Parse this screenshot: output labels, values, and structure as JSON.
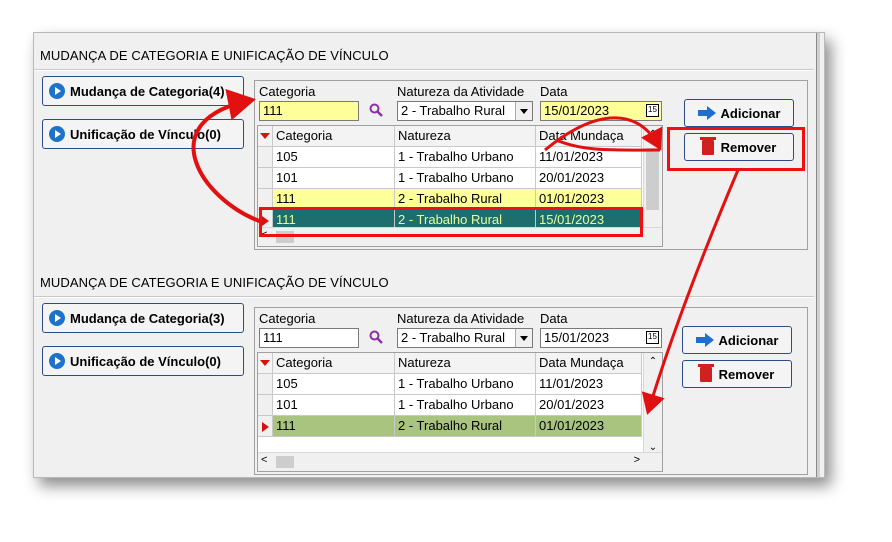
{
  "top": {
    "title": "MUDANÇA DE CATEGORIA E UNIFICAÇÃO DE VÍNCULO",
    "side_buttons": [
      {
        "label": "Mudança de Categoria(4)"
      },
      {
        "label": "Unificação de Vínculo(0)"
      }
    ],
    "labels": {
      "categoria": "Categoria",
      "natureza": "Natureza da Atividade",
      "data": "Data"
    },
    "inputs": {
      "categoria": "111",
      "natureza": "2 - Trabalho Rural",
      "data": "15/01/2023"
    },
    "grid_headers": [
      "Categoria",
      "Natureza",
      "Data Mundaça"
    ],
    "rows": [
      {
        "categoria": "105",
        "natureza": "1 - Trabalho Urbano",
        "data": "11/01/2023"
      },
      {
        "categoria": "101",
        "natureza": "1 - Trabalho Urbano",
        "data": "20/01/2023"
      },
      {
        "categoria": "111",
        "natureza": "2 - Trabalho Rural",
        "data": "01/01/2023"
      },
      {
        "categoria": "111",
        "natureza": "2 - Trabalho Rural",
        "data": "15/01/2023"
      }
    ],
    "add_label": "Adicionar",
    "remove_label": "Remover"
  },
  "bottom": {
    "title": "MUDANÇA DE CATEGORIA E UNIFICAÇÃO DE VÍNCULO",
    "side_buttons": [
      {
        "label": "Mudança de Categoria(3)"
      },
      {
        "label": "Unificação de Vínculo(0)"
      }
    ],
    "labels": {
      "categoria": "Categoria",
      "natureza": "Natureza da Atividade",
      "data": "Data"
    },
    "inputs": {
      "categoria": "111",
      "natureza": "2 - Trabalho Rural",
      "data": "15/01/2023"
    },
    "grid_headers": [
      "Categoria",
      "Natureza",
      "Data Mundaça"
    ],
    "rows": [
      {
        "categoria": "105",
        "natureza": "1 - Trabalho Urbano",
        "data": "11/01/2023"
      },
      {
        "categoria": "101",
        "natureza": "1 - Trabalho Urbano",
        "data": "20/01/2023"
      },
      {
        "categoria": "111",
        "natureza": "2 - Trabalho Rural",
        "data": "01/01/2023"
      }
    ],
    "add_label": "Adicionar",
    "remove_label": "Remover"
  },
  "icons": {
    "search": "magnifier-icon",
    "calendar": "calendar-icon",
    "add": "arrow-right-icon",
    "remove": "trash-icon",
    "side": "play-circle-icon"
  },
  "colors": {
    "accent": "#1f72c9",
    "highlight": "#e11111",
    "selected_dark": "#1e6e6e",
    "selected_green": "#a9c47f",
    "input_yellow": "#ffff99"
  }
}
